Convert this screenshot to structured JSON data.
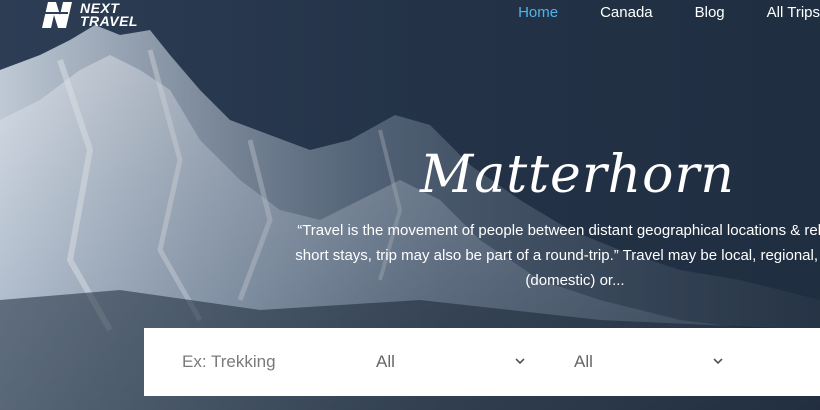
{
  "logo": {
    "line1": "NEXT",
    "line2": "TRAVEL",
    "icon": "n-logo-icon"
  },
  "nav": {
    "items": [
      {
        "label": "Home",
        "active": true
      },
      {
        "label": "Canada",
        "active": false
      },
      {
        "label": "Blog",
        "active": false
      },
      {
        "label": "All Trips",
        "active": false
      }
    ]
  },
  "hero": {
    "title": "Matterhorn",
    "quote_line1": "“Travel is the movement of people between distant geographical locations & relative",
    "quote_line2": "short stays, trip may also be part of a round-trip.” Travel may be local, regional, natio",
    "quote_line3": "(domestic) or..."
  },
  "search": {
    "placeholder": "Ex: Trekking",
    "select1_value": "All",
    "select2_value": "All"
  },
  "colors": {
    "nav_active": "#4fb3ea",
    "text": "#ffffff"
  }
}
